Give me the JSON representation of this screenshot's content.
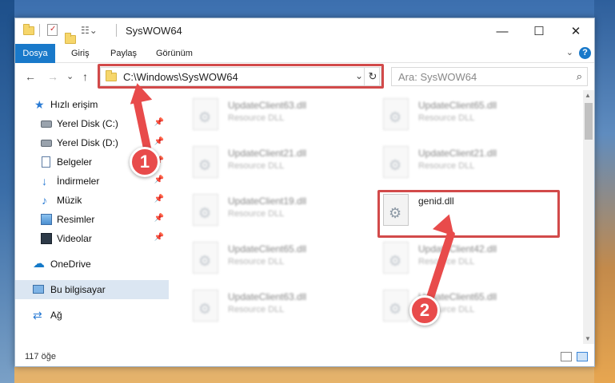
{
  "window": {
    "title": "SysWOW64",
    "minimize": "—",
    "maximize": "☐",
    "close": "✕"
  },
  "ribbon": {
    "tabs": [
      "Dosya",
      "Giriş",
      "Paylaş",
      "Görünüm"
    ],
    "expand": "⌄",
    "help": "?"
  },
  "nav": {
    "back": "←",
    "forward": "→",
    "recent": "⌄",
    "up": "↑",
    "address": "C:\\Windows\\SysWOW64",
    "dropdown": "⌄",
    "refresh": "↻",
    "search_placeholder": "Ara: SysWOW64",
    "search_icon": "⌕"
  },
  "sidebar": {
    "items": [
      {
        "label": "Hızlı erişim",
        "icon": "star-icon"
      },
      {
        "label": "Yerel Disk (C:)",
        "icon": "disk-icon",
        "pinned": true
      },
      {
        "label": "Yerel Disk (D:)",
        "icon": "disk-icon",
        "pinned": true
      },
      {
        "label": "Belgeler",
        "icon": "document-icon",
        "pinned": true
      },
      {
        "label": "İndirmeler",
        "icon": "download-icon",
        "pinned": true
      },
      {
        "label": "Müzik",
        "icon": "music-icon",
        "pinned": true
      },
      {
        "label": "Resimler",
        "icon": "picture-icon",
        "pinned": true
      },
      {
        "label": "Videolar",
        "icon": "video-icon",
        "pinned": true
      },
      {
        "label": "OneDrive",
        "icon": "cloud-icon"
      },
      {
        "label": "Bu bilgisayar",
        "icon": "computer-icon",
        "selected": true
      },
      {
        "label": "Ağ",
        "icon": "network-icon"
      }
    ],
    "pin_glyph": "📌"
  },
  "files": [
    {
      "name": "UpdateClient63.dll",
      "type": "Resource DLL"
    },
    {
      "name": "UpdateClient65.dll",
      "type": "Resource DLL"
    },
    {
      "name": "UpdateClient21.dll",
      "type": "Resource DLL"
    },
    {
      "name": "UpdateClient21.dll",
      "type": "Resource DLL"
    },
    {
      "name": "UpdateClient19.dll",
      "type": "Resource DLL"
    },
    {
      "name": "genid.dll",
      "type": ""
    },
    {
      "name": "UpdateClient65.dll",
      "type": "Resource DLL"
    },
    {
      "name": "UpdateClient42.dll",
      "type": "Resource DLL"
    },
    {
      "name": "UpdateClient63.dll",
      "type": "Resource DLL"
    },
    {
      "name": "UpdateClient65.dll",
      "type": "Resource DLL"
    }
  ],
  "status": {
    "count": "117 öğe"
  },
  "annotations": {
    "step1": "1",
    "step2": "2",
    "color": "#e84b4b"
  }
}
